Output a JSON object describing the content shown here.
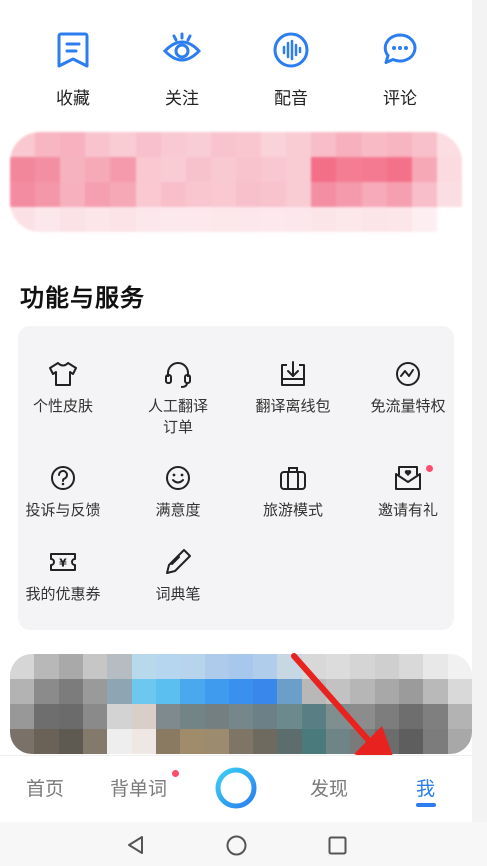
{
  "quick_actions": [
    {
      "label": "收藏",
      "icon": "bookmark-icon"
    },
    {
      "label": "关注",
      "icon": "eye-icon"
    },
    {
      "label": "配音",
      "icon": "voice-icon"
    },
    {
      "label": "评论",
      "icon": "comment-icon"
    }
  ],
  "services": {
    "title": "功能与服务",
    "items": [
      {
        "label": "个性皮肤",
        "icon": "tshirt-icon"
      },
      {
        "label": "人工翻译\n订单",
        "icon": "headset-icon"
      },
      {
        "label": "翻译离线包",
        "icon": "download-icon"
      },
      {
        "label": "免流量特权",
        "icon": "traffic-icon"
      },
      {
        "label": "投诉与反馈",
        "icon": "help-icon"
      },
      {
        "label": "满意度",
        "icon": "smile-icon"
      },
      {
        "label": "旅游模式",
        "icon": "suitcase-icon"
      },
      {
        "label": "邀请有礼",
        "icon": "invite-icon"
      },
      {
        "label": "我的优惠券",
        "icon": "coupon-icon"
      },
      {
        "label": "词典笔",
        "icon": "pen-icon"
      }
    ]
  },
  "bottom_nav": {
    "home": "首页",
    "vocab": "背单词",
    "discover": "发现",
    "me": "我"
  },
  "colors": {
    "accent": "#2b7df0",
    "badge": "#ff4d6d",
    "arrow": "#e8231f"
  }
}
